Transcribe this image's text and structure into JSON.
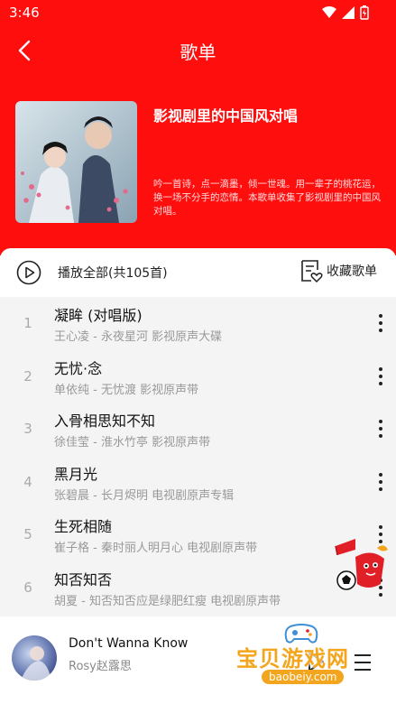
{
  "status_bar": {
    "time": "3:46"
  },
  "header": {
    "title": "歌单",
    "background": "#ff0e0e"
  },
  "playlist": {
    "name": "影视剧里的中国风对唱",
    "description": "吟一首诗，点一滴墨，倾一世魂。用一辈子的桃花运，换一场不分手的恋情。本歌单收集了影视剧里的中国风对唱。"
  },
  "actions": {
    "play_all": "播放全部(共105首)",
    "collect": "收藏歌单"
  },
  "songs": [
    {
      "index": "1",
      "title": "凝眸 (对唱版)",
      "subtitle": "王心凌 - 永夜星河 影视原声大碟"
    },
    {
      "index": "2",
      "title": "无忧·念",
      "subtitle": "单依纯 - 无忧渡 影视原声带"
    },
    {
      "index": "3",
      "title": "入骨相思知不知",
      "subtitle": "徐佳莹 - 淮水竹亭 影视原声带"
    },
    {
      "index": "4",
      "title": "黑月光",
      "subtitle": "张碧晨 - 长月烬明 电视剧原声专辑"
    },
    {
      "index": "5",
      "title": "生死相随",
      "subtitle": "崔子格 - 秦时丽人明月心 电视剧原声带"
    },
    {
      "index": "6",
      "title": "知否知否",
      "subtitle": "胡夏 - 知否知否应是绿肥红瘦 电视剧原声带"
    }
  ],
  "player": {
    "title": "Don't Wanna Know",
    "artist": "Rosy赵露思"
  },
  "watermark": {
    "name": "宝贝游戏网",
    "url": "baobeiy.com"
  },
  "icons": {
    "back": "back-arrow-icon",
    "play_all": "play-circle-icon",
    "collect": "playlist-heart-icon",
    "more": "more-vertical-icon",
    "player_play": "play-icon",
    "queue": "queue-list-icon"
  }
}
